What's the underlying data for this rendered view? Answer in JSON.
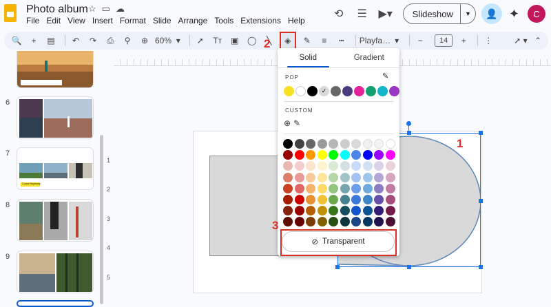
{
  "app": {
    "title": "Photo album",
    "menu": [
      "File",
      "Edit",
      "View",
      "Insert",
      "Format",
      "Slide",
      "Arrange",
      "Tools",
      "Extensions",
      "Help"
    ],
    "slideshow_label": "Slideshow",
    "avatar_letter": "C"
  },
  "toolbar": {
    "zoom": "60%",
    "font": "Playfa…",
    "font_size": "14",
    "minus": "−",
    "plus": "+"
  },
  "filmstrip": {
    "slides": [
      {
        "number": "6"
      },
      {
        "number": "7",
        "caption": "Coast Highway"
      },
      {
        "number": "8"
      },
      {
        "number": "9"
      }
    ]
  },
  "ruler": {
    "left_marks": [
      "1",
      "2",
      "3",
      "4",
      "5"
    ]
  },
  "annotations": {
    "step1": "1",
    "step2": "2",
    "step3": "3"
  },
  "fill_menu": {
    "tabs": [
      "Solid",
      "Gradient"
    ],
    "pop_label": "POP",
    "custom_label": "CUSTOM",
    "transparent_label": "Transparent",
    "pop_colors": [
      "#f4e225",
      "#ffffff",
      "#000000",
      "#d9d9d9",
      "#666666",
      "#4a3b7c",
      "#e3239a",
      "#13a06f",
      "#11b5c8",
      "#9a36c4"
    ],
    "selected_pop_index": 3,
    "grid_colors": [
      [
        "#000000",
        "#434343",
        "#666666",
        "#999999",
        "#b7b7b7",
        "#cccccc",
        "#d9d9d9",
        "#efefef",
        "#f3f3f3",
        "#ffffff"
      ],
      [
        "#980000",
        "#ff0000",
        "#ff9900",
        "#ffff00",
        "#00ff00",
        "#00ffff",
        "#4a86e8",
        "#0000ff",
        "#9900ff",
        "#ff00ff"
      ],
      [
        "#e6b8af",
        "#f4cccc",
        "#fce5cd",
        "#fff2cc",
        "#d9ead3",
        "#d0e0e3",
        "#c9daf8",
        "#cfe2f3",
        "#d9d2e9",
        "#ead1dc"
      ],
      [
        "#dd7e6b",
        "#ea9999",
        "#f9cb9c",
        "#ffe599",
        "#b6d7a8",
        "#a2c4c9",
        "#a4c2f4",
        "#9fc5e8",
        "#b4a7d6",
        "#d5a6bd"
      ],
      [
        "#cc4125",
        "#e06666",
        "#f6b26b",
        "#ffd966",
        "#93c47d",
        "#76a5af",
        "#6d9eeb",
        "#6fa8dc",
        "#8e7cc3",
        "#c27ba0"
      ],
      [
        "#a61c00",
        "#cc0000",
        "#e69138",
        "#f1c232",
        "#6aa84f",
        "#45818e",
        "#3c78d8",
        "#3d85c6",
        "#674ea7",
        "#a64d79"
      ],
      [
        "#85200c",
        "#990000",
        "#b45f06",
        "#bf9000",
        "#38761d",
        "#134f5c",
        "#1155cc",
        "#0b5394",
        "#351c75",
        "#741b47"
      ],
      [
        "#5b0f00",
        "#660000",
        "#783f04",
        "#7f6000",
        "#274e13",
        "#0c343d",
        "#1c4587",
        "#073763",
        "#20124d",
        "#4c1130"
      ]
    ]
  }
}
